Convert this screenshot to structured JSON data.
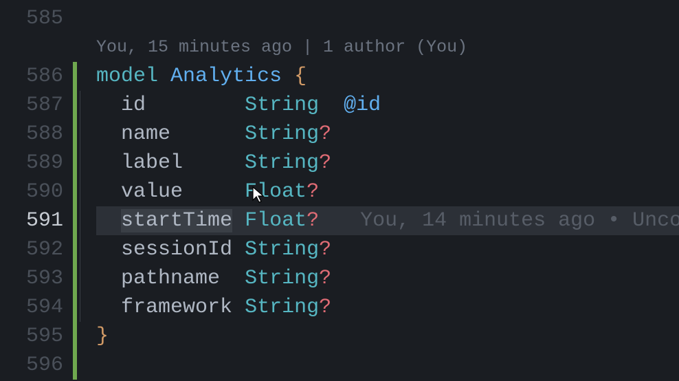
{
  "lines": {
    "start": 585,
    "active": 591,
    "numbers": [
      "585",
      "586",
      "587",
      "588",
      "589",
      "590",
      "591",
      "592",
      "593",
      "594",
      "595",
      "596"
    ]
  },
  "codelens": {
    "text": "You, 15 minutes ago | 1 author (You)"
  },
  "model": {
    "keyword": "model",
    "name": "Analytics",
    "open": "{",
    "close": "}",
    "fields": [
      {
        "name": "id",
        "type": "String",
        "optional": false,
        "attr": "@id"
      },
      {
        "name": "name",
        "type": "String",
        "optional": true,
        "attr": ""
      },
      {
        "name": "label",
        "type": "String",
        "optional": true,
        "attr": ""
      },
      {
        "name": "value",
        "type": "Float",
        "optional": true,
        "attr": ""
      },
      {
        "name": "startTime",
        "type": "Float",
        "optional": true,
        "attr": ""
      },
      {
        "name": "sessionId",
        "type": "String",
        "optional": true,
        "attr": ""
      },
      {
        "name": "pathname",
        "type": "String",
        "optional": true,
        "attr": ""
      },
      {
        "name": "framework",
        "type": "String",
        "optional": true,
        "attr": ""
      }
    ]
  },
  "blame": {
    "line591": "You, 14 minutes ago • Unco"
  },
  "optional_mark": "?"
}
